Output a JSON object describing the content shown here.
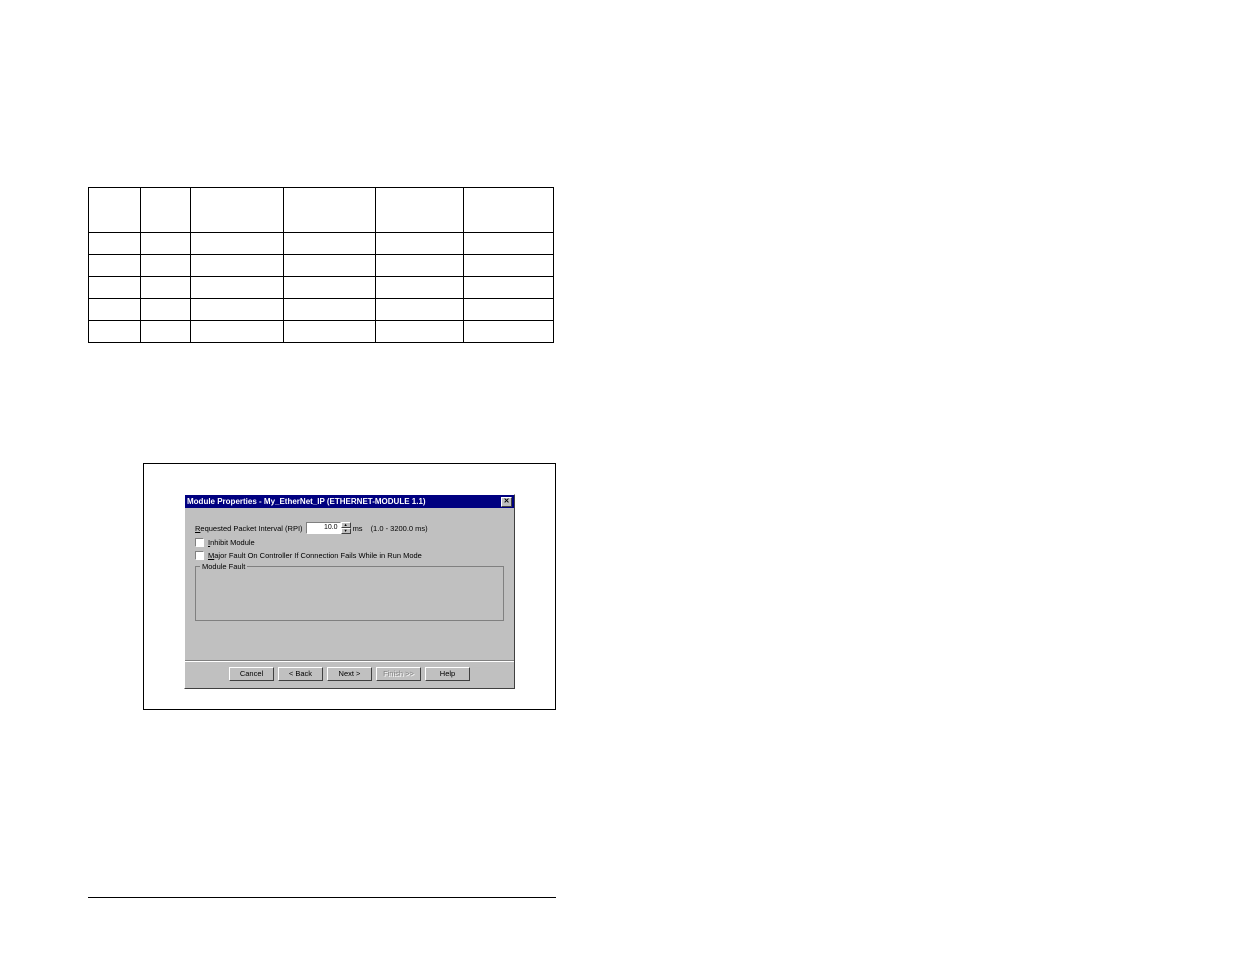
{
  "dialog": {
    "title": "Module Properties - My_EtherNet_IP (ETHERNET-MODULE 1.1)",
    "rpi_label": "Requested Packet Interval (RPI)",
    "rpi_value": "10.0",
    "rpi_unit": "ms",
    "rpi_range": "(1.0 - 3200.0 ms)",
    "inhibit_label": "Inhibit Module",
    "major_fault_label": "Major Fault On Controller If Connection Fails While in Run Mode",
    "module_fault_label": "Module Fault",
    "buttons": {
      "cancel": "Cancel",
      "back": "< Back",
      "next": "Next >",
      "finish": "Finish >>",
      "help": "Help"
    }
  }
}
